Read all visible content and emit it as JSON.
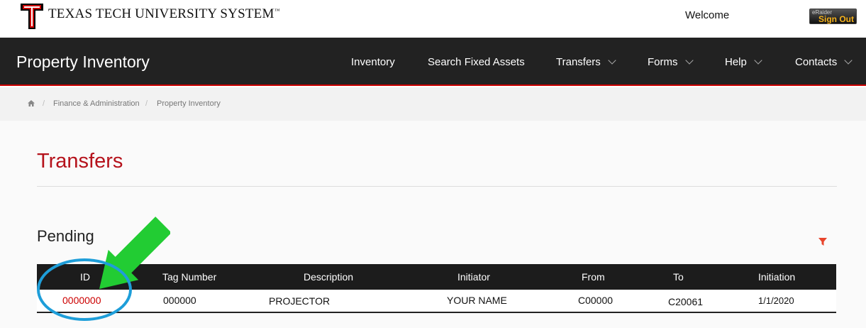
{
  "header": {
    "logo_text": "TEXAS TECH UNIVERSITY SYSTEM",
    "logo_mark": "™",
    "welcome": "Welcome",
    "signout_small": "eRaider",
    "signout_label": "Sign Out"
  },
  "nav": {
    "app_title": "Property Inventory",
    "items": [
      {
        "label": "Inventory",
        "dropdown": false
      },
      {
        "label": "Search Fixed Assets",
        "dropdown": false
      },
      {
        "label": "Transfers",
        "dropdown": true
      },
      {
        "label": "Forms",
        "dropdown": true
      },
      {
        "label": "Help",
        "dropdown": true
      },
      {
        "label": "Contacts",
        "dropdown": true
      }
    ]
  },
  "breadcrumb": {
    "items": [
      "Finance & Administration",
      "Property Inventory"
    ],
    "separator": "/"
  },
  "page": {
    "title": "Transfers",
    "section": "Pending"
  },
  "table": {
    "columns": [
      "ID",
      "Tag Number",
      "Description",
      "Initiator",
      "From",
      "To",
      "Initiation"
    ],
    "rows": [
      {
        "id": "0000000",
        "tag": "000000",
        "description": "PROJECTOR",
        "initiator": "YOUR NAME",
        "from": "C00000",
        "to": "C20061",
        "initiation": "1/1/2020"
      }
    ]
  },
  "colors": {
    "brand_red": "#cc0000",
    "title_red": "#b5121b",
    "navbar": "#222222",
    "annotation_arrow": "#22cc33",
    "annotation_circle": "#1e9ed9"
  }
}
